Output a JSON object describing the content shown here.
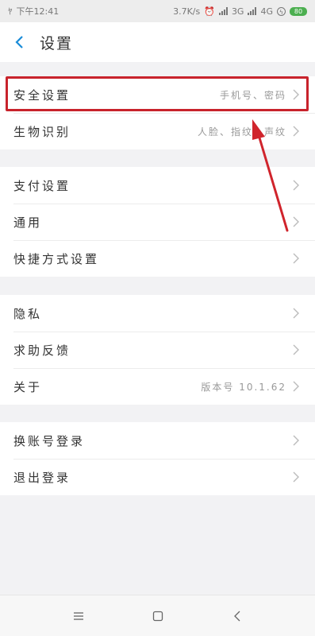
{
  "status_bar": {
    "time": "下午12:41",
    "network_speed": "3.7K/s",
    "network_3g": "3G",
    "network_4g": "4G",
    "battery": "80"
  },
  "header": {
    "back_icon": "chevron-left-icon",
    "title": "设置"
  },
  "groups": [
    {
      "items": [
        {
          "label": "安全设置",
          "value": "手机号、密码"
        },
        {
          "label": "生物识别",
          "value": "人脸、指纹、声纹"
        }
      ]
    },
    {
      "items": [
        {
          "label": "支付设置",
          "value": ""
        },
        {
          "label": "通用",
          "value": ""
        },
        {
          "label": "快捷方式设置",
          "value": ""
        }
      ]
    },
    {
      "items": [
        {
          "label": "隐私",
          "value": ""
        },
        {
          "label": "求助反馈",
          "value": ""
        },
        {
          "label": "关于",
          "value": "版本号 10.1.62"
        }
      ]
    },
    {
      "items": [
        {
          "label": "换账号登录",
          "value": ""
        },
        {
          "label": "退出登录",
          "value": ""
        }
      ]
    }
  ],
  "annotation": {
    "highlight_color": "#c8232c",
    "arrow_color": "#d0242c"
  },
  "nav_bar": {
    "menu_icon": "menu-icon",
    "home_icon": "home-square-icon",
    "back_icon": "back-triangle-icon"
  }
}
